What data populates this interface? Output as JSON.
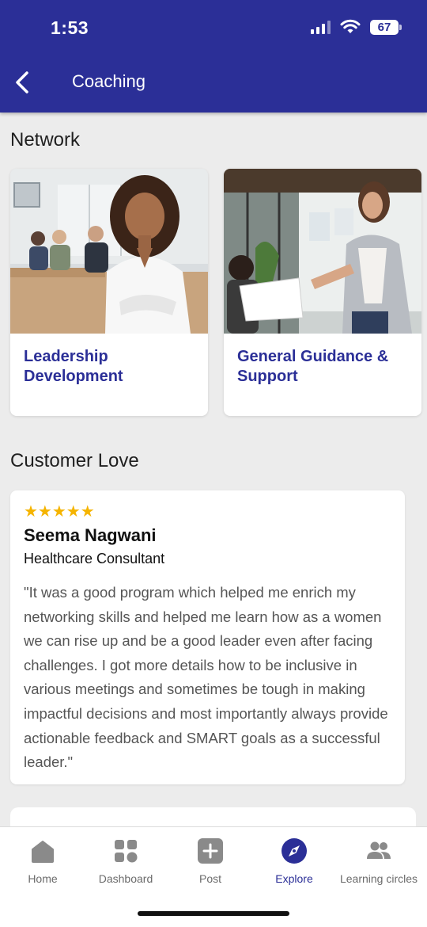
{
  "status_bar": {
    "time": "1:53",
    "battery": "67"
  },
  "header": {
    "title": "Coaching"
  },
  "network": {
    "title": "Network",
    "cards": [
      {
        "label": "Leadership Development",
        "image": "businesswoman-portrait-photo"
      },
      {
        "label": "General Guidance & Support",
        "image": "office-meeting-photo"
      }
    ]
  },
  "customer_love": {
    "title": "Customer Love",
    "review": {
      "rating": 5,
      "stars": "★★★★★",
      "name": "Seema Nagwani",
      "role": "Healthcare Consultant",
      "text": "\"It was a good program which helped me enrich my networking skills and helped me learn how as a women we can rise up and be a good leader even after facing challenges. I got more details how to be inclusive in various meetings and sometimes be tough in making impactful decisions and most importantly always provide actionable feedback and SMART goals as a successful leader.\""
    }
  },
  "bottom_nav": {
    "items": [
      {
        "label": "Home",
        "icon": "home-icon"
      },
      {
        "label": "Dashboard",
        "icon": "dashboard-icon"
      },
      {
        "label": "Post",
        "icon": "plus-icon"
      },
      {
        "label": "Explore",
        "icon": "compass-icon",
        "active": true
      },
      {
        "label": "Learning circles",
        "icon": "people-icon"
      }
    ]
  },
  "colors": {
    "primary": "#2b2f97",
    "star": "#f5b400",
    "background": "#ececec"
  }
}
